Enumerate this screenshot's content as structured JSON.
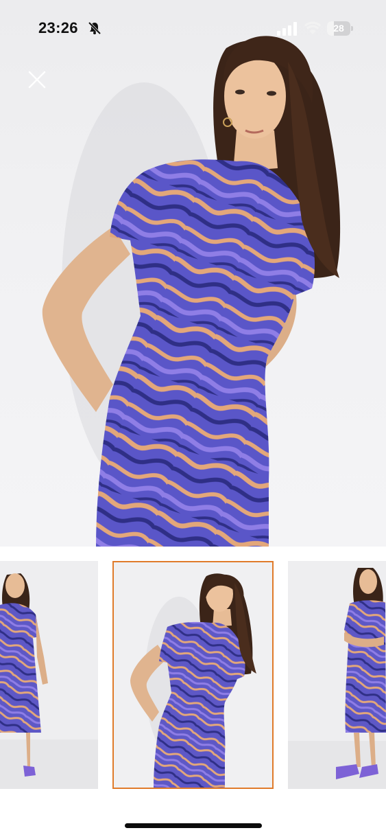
{
  "status_bar": {
    "time": "23:26",
    "battery_level": "28",
    "battery_fraction": 0.28,
    "icons": [
      "bell-slash-icon",
      "cellular-signal-icon",
      "wifi-icon",
      "battery-icon"
    ]
  },
  "viewer": {
    "close_icon": "close-icon",
    "selected_index": 1,
    "accent_color": "#e07b2a",
    "dress_colors": [
      "#5a56c8",
      "#8f7ee6",
      "#e3a77a",
      "#2f2f86"
    ],
    "images": [
      {
        "name": "product-image-front-full"
      },
      {
        "name": "product-image-lean-closeup"
      },
      {
        "name": "product-image-arms-crossed"
      }
    ]
  }
}
